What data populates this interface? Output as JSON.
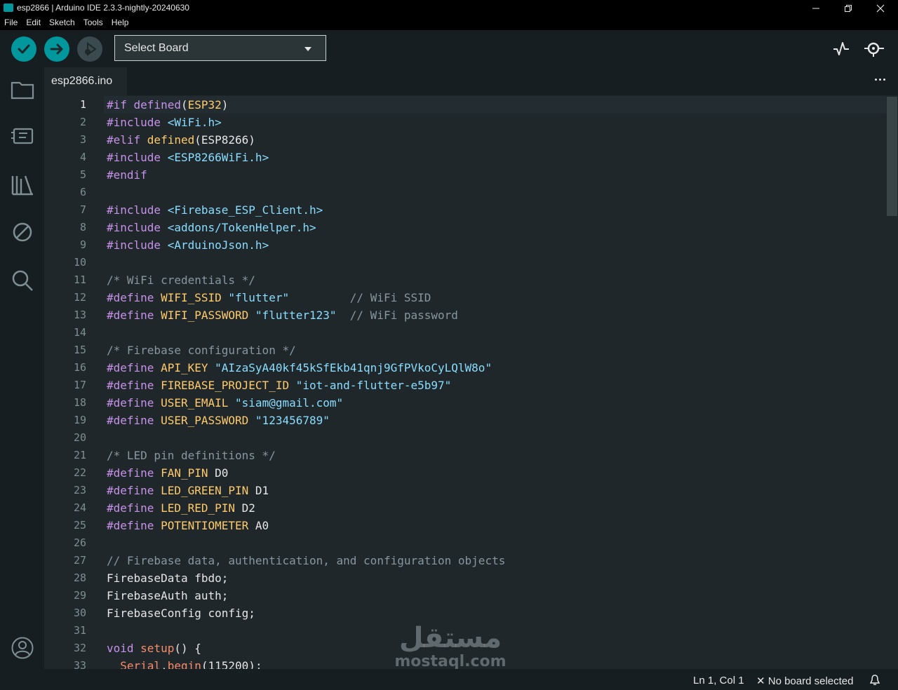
{
  "window": {
    "title": "esp2866 | Arduino IDE 2.3.3-nightly-20240630"
  },
  "menu": [
    "File",
    "Edit",
    "Sketch",
    "Tools",
    "Help"
  ],
  "toolbar": {
    "board_label": "Select Board"
  },
  "tab": {
    "filename": "esp2866.ino"
  },
  "colors": {
    "accent": "#00979d",
    "background": "#1f272a",
    "keyword": "#c792ea",
    "define_name": "#ffcb6b",
    "string": "#89ddff",
    "comment": "#8797a0",
    "function": "#f78c6c"
  },
  "icons": [
    "verify-icon",
    "upload-icon",
    "debug-icon",
    "serial-plotter-icon",
    "serial-monitor-icon",
    "sketchbook-icon",
    "boards-manager-icon",
    "library-manager-icon",
    "debug-panel-icon",
    "search-icon",
    "account-icon",
    "bell-icon"
  ],
  "editor": {
    "line_numbers": [
      "1",
      "2",
      "3",
      "4",
      "5",
      "6",
      "7",
      "8",
      "9",
      "10",
      "11",
      "12",
      "13",
      "14",
      "15",
      "16",
      "17",
      "18",
      "19",
      "20",
      "21",
      "22",
      "23",
      "24",
      "25",
      "26",
      "27",
      "28",
      "29",
      "30",
      "31",
      "32",
      "33"
    ],
    "lines": [
      [
        [
          "k",
          "#if defined"
        ],
        [
          "",
          "("
        ],
        [
          "d",
          "ESP32"
        ],
        [
          "",
          ")"
        ]
      ],
      [
        [
          "k",
          "#include "
        ],
        [
          "s",
          "<WiFi.h>"
        ]
      ],
      [
        [
          "k",
          "#elif "
        ],
        [
          "d",
          "defined"
        ],
        [
          "",
          "(ESP8266)"
        ]
      ],
      [
        [
          "k",
          "#include "
        ],
        [
          "s",
          "<ESP8266WiFi.h>"
        ]
      ],
      [
        [
          "k",
          "#endif"
        ]
      ],
      [],
      [
        [
          "k",
          "#include "
        ],
        [
          "s",
          "<Firebase_ESP_Client.h>"
        ]
      ],
      [
        [
          "k",
          "#include "
        ],
        [
          "s",
          "<addons/TokenHelper.h>"
        ]
      ],
      [
        [
          "k",
          "#include "
        ],
        [
          "s",
          "<ArduinoJson.h>"
        ]
      ],
      [],
      [
        [
          "c",
          "/* WiFi credentials */"
        ]
      ],
      [
        [
          "k",
          "#define "
        ],
        [
          "d",
          "WIFI_SSID "
        ],
        [
          "s",
          "\"flutter\""
        ],
        [
          "",
          "         "
        ],
        [
          "c",
          "// WiFi SSID"
        ]
      ],
      [
        [
          "k",
          "#define "
        ],
        [
          "d",
          "WIFI_PASSWORD "
        ],
        [
          "s",
          "\"flutter123\""
        ],
        [
          "",
          "  "
        ],
        [
          "c",
          "// WiFi password"
        ]
      ],
      [],
      [
        [
          "c",
          "/* Firebase configuration */"
        ]
      ],
      [
        [
          "k",
          "#define "
        ],
        [
          "d",
          "API_KEY "
        ],
        [
          "s",
          "\"AIzaSyA40kf45kSfEkb41qnj9GfPVkoCyLQlW8o\""
        ]
      ],
      [
        [
          "k",
          "#define "
        ],
        [
          "d",
          "FIREBASE_PROJECT_ID "
        ],
        [
          "s",
          "\"iot-and-flutter-e5b97\""
        ]
      ],
      [
        [
          "k",
          "#define "
        ],
        [
          "d",
          "USER_EMAIL "
        ],
        [
          "s",
          "\"siam@gmail.com\""
        ]
      ],
      [
        [
          "k",
          "#define "
        ],
        [
          "d",
          "USER_PASSWORD "
        ],
        [
          "s",
          "\"123456789\""
        ]
      ],
      [],
      [
        [
          "c",
          "/* LED pin definitions */"
        ]
      ],
      [
        [
          "k",
          "#define "
        ],
        [
          "d",
          "FAN_PIN "
        ],
        [
          "",
          "D0"
        ]
      ],
      [
        [
          "k",
          "#define "
        ],
        [
          "d",
          "LED_GREEN_PIN "
        ],
        [
          "",
          "D1"
        ]
      ],
      [
        [
          "k",
          "#define "
        ],
        [
          "d",
          "LED_RED_PIN "
        ],
        [
          "",
          "D2"
        ]
      ],
      [
        [
          "k",
          "#define "
        ],
        [
          "d",
          "POTENTIOMETER "
        ],
        [
          "",
          "A0"
        ]
      ],
      [],
      [
        [
          "c",
          "// Firebase data, authentication, and configuration objects"
        ]
      ],
      [
        [
          "",
          "FirebaseData fbdo;"
        ]
      ],
      [
        [
          "",
          "FirebaseAuth auth;"
        ]
      ],
      [
        [
          "",
          "FirebaseConfig config;"
        ]
      ],
      [],
      [
        [
          "k",
          "void "
        ],
        [
          "f",
          "setup"
        ],
        [
          "",
          "() {"
        ]
      ],
      [
        [
          "",
          "  "
        ],
        [
          "f",
          "Serial"
        ],
        [
          "",
          "."
        ],
        [
          "f",
          "begin"
        ],
        [
          "",
          "(115200);"
        ]
      ]
    ]
  },
  "status": {
    "position": "Ln 1, Col 1",
    "board": "No board selected"
  },
  "watermark": {
    "arabic": "مستقل",
    "latin": "mostaql.com"
  }
}
